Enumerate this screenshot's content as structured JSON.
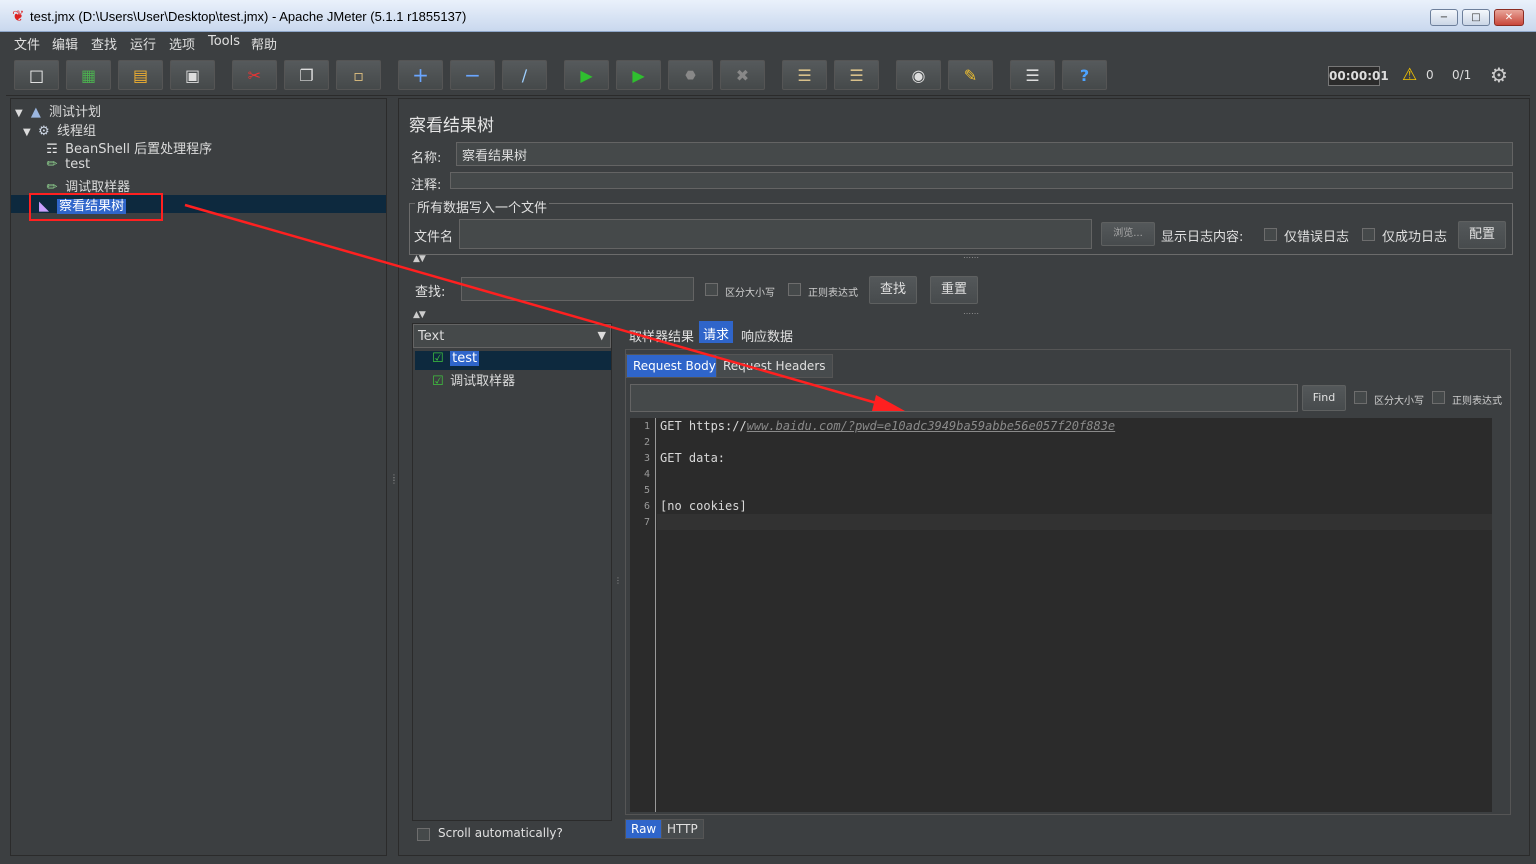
{
  "window": {
    "title": "test.jmx (D:\\Users\\User\\Desktop\\test.jmx) - Apache JMeter (5.1.1 r1855137)",
    "minimize": "−",
    "maximize": "□",
    "close": "✕"
  },
  "menu": [
    "文件",
    "编辑",
    "查找",
    "运行",
    "选项",
    "Tools",
    "帮助"
  ],
  "toolbar": {
    "timer": "00:00:01",
    "warnings": "0",
    "threads": "0/1"
  },
  "tree": {
    "items": [
      {
        "label": "测试计划",
        "icon": "test-plan-icon"
      },
      {
        "label": "线程组",
        "icon": "gear-icon"
      },
      {
        "label": "BeanShell 后置处理程序",
        "icon": "script-icon"
      },
      {
        "label": "test",
        "icon": "sampler-icon"
      },
      {
        "label": "调试取样器",
        "icon": "sampler-icon"
      },
      {
        "label": "察看结果树",
        "icon": "chart-icon"
      }
    ]
  },
  "panel": {
    "title": "察看结果树",
    "name_label": "名称:",
    "name_value": "察看结果树",
    "comment_label": "注释:",
    "file_group": "所有数据写入一个文件",
    "filename_label": "文件名",
    "browse": "浏览...",
    "log_label": "显示日志内容:",
    "errors_only": "仅错误日志",
    "success_only": "仅成功日志",
    "configure": "配置",
    "search_label": "查找:",
    "case_sensitive": "区分大小写",
    "regex": "正则表达式",
    "search_button": "查找",
    "reset_button": "重置"
  },
  "results": {
    "renderer": "Text",
    "items": [
      "test",
      "调试取样器"
    ],
    "scroll_auto": "Scroll automatically?"
  },
  "detail": {
    "tabs": [
      "取样器结果",
      "请求",
      "响应数据"
    ],
    "subtabs": [
      "Request Body",
      "Request Headers"
    ],
    "find_button": "Find",
    "case_sensitive": "区分大小写",
    "regex": "正则表达式",
    "lines": [
      {
        "n": "1",
        "prefix": "GET https://",
        "url": "www.baidu.com/?pwd=e10adc3949ba59abbe56e057f20f883e"
      },
      {
        "n": "2",
        "prefix": "",
        "url": ""
      },
      {
        "n": "3",
        "prefix": "GET data:",
        "url": ""
      },
      {
        "n": "4",
        "prefix": "",
        "url": ""
      },
      {
        "n": "5",
        "prefix": "",
        "url": ""
      },
      {
        "n": "6",
        "prefix": "[no cookies]",
        "url": ""
      },
      {
        "n": "7",
        "prefix": "",
        "url": ""
      }
    ],
    "bottom_tabs": [
      "Raw",
      "HTTP"
    ]
  },
  "colors": {
    "background": "#3c3f41",
    "selection": "#2f65ca",
    "annotation": "#ff2020",
    "success": "#3fc33f"
  }
}
